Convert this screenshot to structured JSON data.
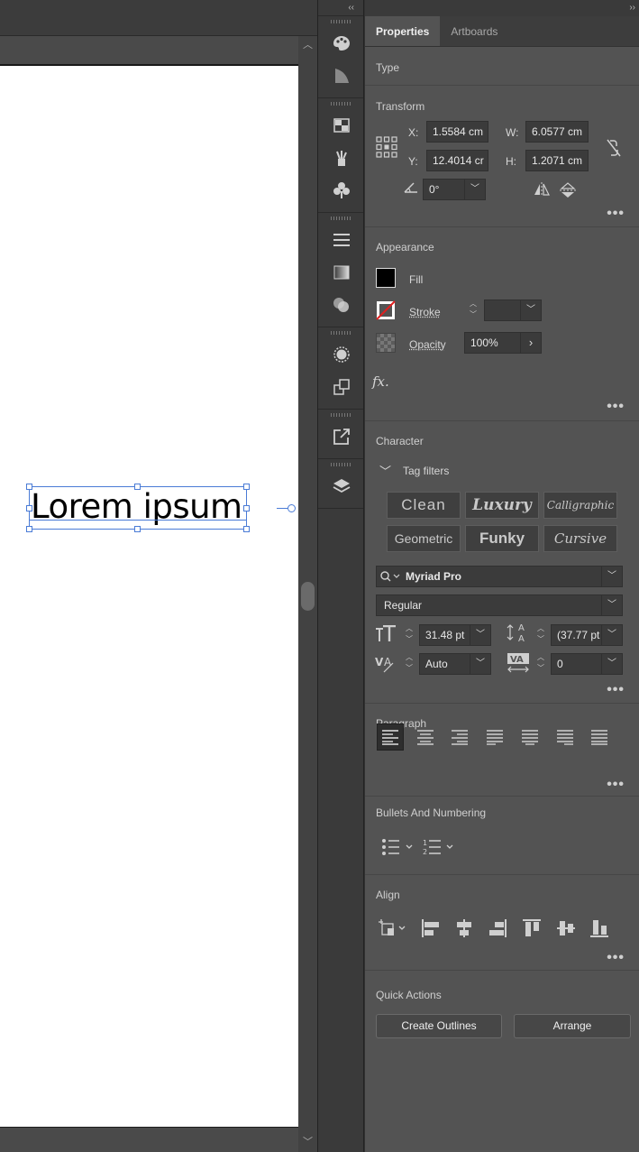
{
  "canvas": {
    "text_content": "Lorem ipsum"
  },
  "panel": {
    "tabs": [
      "Properties",
      "Artboards"
    ],
    "active_tab": "Properties",
    "collapse_glyph": "››",
    "toolstrip_collapse_glyph": "‹‹"
  },
  "type_section": {
    "title": "Type"
  },
  "transform": {
    "title": "Transform",
    "x_label": "X:",
    "x_value": "1.5584 cm",
    "y_label": "Y:",
    "y_value": "12.4014 cr",
    "w_label": "W:",
    "w_value": "6.0577 cm",
    "h_label": "H:",
    "h_value": "1.2071 cm",
    "angle_value": "0°"
  },
  "appearance": {
    "title": "Appearance",
    "fill_label": "Fill",
    "stroke_label": "Stroke",
    "opacity_label": "Opacity",
    "opacity_value": "100%",
    "fx_label": "fx.",
    "fill_color": "#000000"
  },
  "character": {
    "title": "Character",
    "tag_filters_label": "Tag filters",
    "tags": [
      "Clean",
      "Luxury",
      "Calligraphic",
      "Geometric",
      "Funky",
      "Cursive"
    ],
    "font_family": "Myriad Pro",
    "font_style": "Regular",
    "font_size": "31.48 pt",
    "leading": "(37.77 pt",
    "kerning": "Auto",
    "tracking": "0"
  },
  "paragraph": {
    "title": "Paragraph"
  },
  "bullets": {
    "title": "Bullets And Numbering"
  },
  "align": {
    "title": "Align"
  },
  "quick_actions": {
    "title": "Quick Actions",
    "create_outlines": "Create Outlines",
    "arrange": "Arrange"
  },
  "colors": {
    "panel_bg": "#535353",
    "selection": "#4a7bd6",
    "accent_text": "#f0f0f0"
  }
}
